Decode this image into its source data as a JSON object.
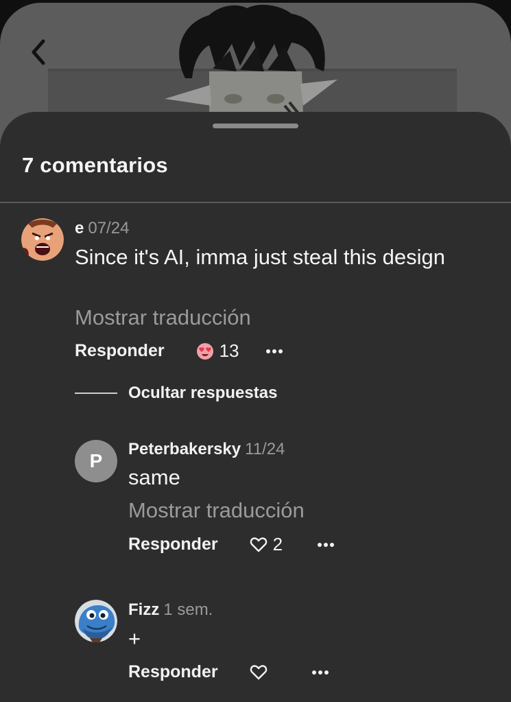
{
  "sheet": {
    "title": "7 comentarios"
  },
  "comments": [
    {
      "author": "e",
      "date": "07/24",
      "text": "Since it's AI, imma just steal this design",
      "translate_label": "Mostrar traducción",
      "reply_label": "Responder",
      "like_count": "13",
      "like_icon": "heart-eyes-reaction-icon",
      "hide_replies_label": "Ocultar respuestas",
      "avatar_icon": "shouting-face-avatar"
    },
    {
      "author": "Peterbakersky",
      "date": "11/24",
      "text": "same",
      "translate_label": "Mostrar traducción",
      "reply_label": "Responder",
      "like_count": "2",
      "like_icon": "heart-outline-icon",
      "avatar_letter": "P"
    },
    {
      "author": "Fizz",
      "date": "1 sem.",
      "text": "+",
      "reply_label": "Responder",
      "like_icon": "heart-outline-icon",
      "avatar_icon": "blue-fish-avatar"
    }
  ],
  "colors": {
    "sheet_bg": "#2d2d2d",
    "muted_text": "#9b9b9b",
    "heart_red": "#e0384f"
  }
}
